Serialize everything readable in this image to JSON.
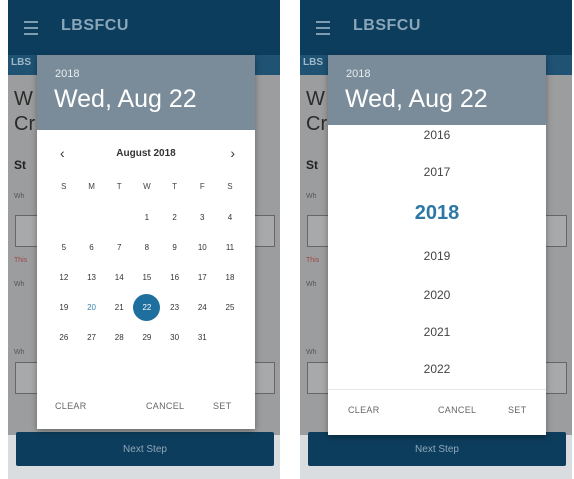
{
  "app": {
    "title": "LBSFCU",
    "subbar_left": "LBS",
    "subbar_right": "LBS"
  },
  "background": {
    "big_line1": "W",
    "big_line2": "Cr",
    "step_label": "St",
    "small_label_1": "Wh",
    "small_label_2": "Wh",
    "small_label_3": "Wh",
    "red_text": "This",
    "next_button": "Next Step"
  },
  "left_picker": {
    "header_year": "2018",
    "header_date": "Wed, Aug 22",
    "month_label": "August 2018",
    "prev_glyph": "‹",
    "next_glyph": "›",
    "weekdays": [
      "S",
      "M",
      "T",
      "W",
      "T",
      "F",
      "S"
    ],
    "days": [
      "",
      "",
      "",
      "1",
      "2",
      "3",
      "4",
      "5",
      "6",
      "7",
      "8",
      "9",
      "10",
      "11",
      "12",
      "13",
      "14",
      "15",
      "16",
      "17",
      "18",
      "19",
      "20",
      "21",
      "22",
      "23",
      "24",
      "25",
      "26",
      "27",
      "28",
      "29",
      "30",
      "31"
    ],
    "selected_day": "22",
    "today_day": "20",
    "clear_label": "CLEAR",
    "cancel_label": "CANCEL",
    "set_label": "SET"
  },
  "right_picker": {
    "header_year": "2018",
    "header_date": "Wed, Aug 22",
    "years": [
      "2016",
      "2017",
      "2018",
      "2019",
      "2020",
      "2021",
      "2022"
    ],
    "selected_year": "2018",
    "clear_label": "CLEAR",
    "cancel_label": "CANCEL",
    "set_label": "SET"
  },
  "colors": {
    "appbar": "#0d3d5c",
    "dialog_header": "#7a8c99",
    "accent": "#1f6f9e"
  }
}
